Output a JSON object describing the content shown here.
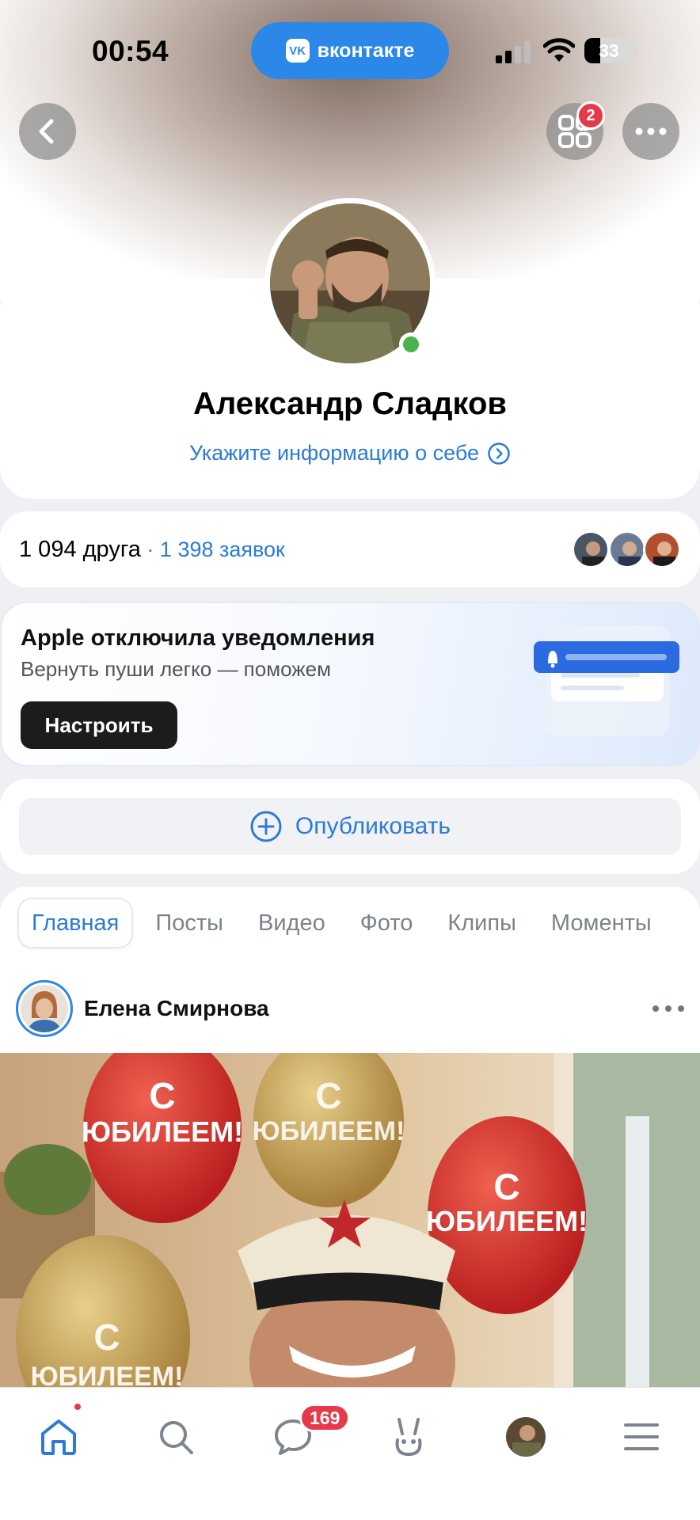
{
  "status_bar": {
    "time": "00:54",
    "app_pill": "вконтакте",
    "vk_logo": "VK",
    "battery": "33"
  },
  "header": {
    "back_icon": "chevron-left-icon",
    "services_badge": "2",
    "services_icon": "grid-icon",
    "more_icon": "more-horizontal-icon"
  },
  "profile": {
    "name": "Александр Сладков",
    "info_link": "Укажите информацию о себе",
    "online": true
  },
  "friends": {
    "count_label": "1 094 друга",
    "separator": " · ",
    "requests_label": "1 398 заявок"
  },
  "notification": {
    "title": "Apple отключила уведомления",
    "subtitle": "Вернуть пуши легко — поможем",
    "button": "Настроить"
  },
  "publish": {
    "label": "Опубликовать"
  },
  "tabs": [
    {
      "label": "Главная",
      "active": true
    },
    {
      "label": "Посты",
      "active": false
    },
    {
      "label": "Видео",
      "active": false
    },
    {
      "label": "Фото",
      "active": false
    },
    {
      "label": "Клипы",
      "active": false
    },
    {
      "label": "Моменты",
      "active": false
    }
  ],
  "post": {
    "author": "Елена Смирнова",
    "image_balloon_text_1": "С",
    "image_balloon_text_2": "ЮБИЛЕЕМ!"
  },
  "bottom_nav": {
    "items": [
      "home-icon",
      "search-icon",
      "messages-icon",
      "clips-icon",
      "profile-avatar",
      "menu-icon"
    ],
    "messages_badge": "169"
  },
  "colors": {
    "accent": "#2b7bd6",
    "badge": "#e6394a",
    "online": "#4bb34b",
    "pill": "#2b87e8"
  }
}
